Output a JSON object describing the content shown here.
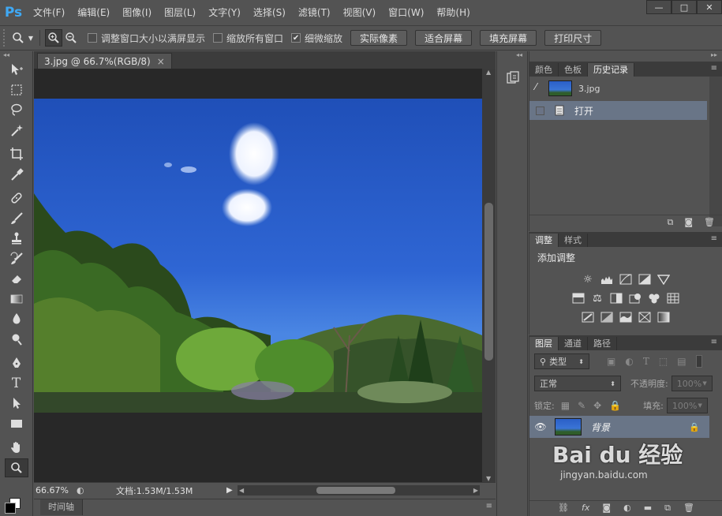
{
  "app": {
    "logo": "Ps"
  },
  "menu": [
    "文件(F)",
    "编辑(E)",
    "图像(I)",
    "图层(L)",
    "文字(Y)",
    "选择(S)",
    "滤镜(T)",
    "视图(V)",
    "窗口(W)",
    "帮助(H)"
  ],
  "window_controls": {
    "minimize": "—",
    "restore": "□",
    "close": "✕"
  },
  "options": {
    "resize_windows_label": "调整窗口大小以满屏显示",
    "zoom_all_label": "缩放所有窗口",
    "scrubby_label": "细微缩放",
    "actual_pixels": "实际像素",
    "fit_screen": "适合屏幕",
    "fill_screen": "填充屏幕",
    "print_size": "打印尺寸",
    "zoom_all_checked": false,
    "scrubby_checked": true
  },
  "document": {
    "tab_title": "3.jpg @ 66.7%(RGB/8)",
    "tab_close": "×",
    "zoom": "66.67%",
    "doc_size": "文档:1.53M/1.53M"
  },
  "timeline": {
    "label": "时间轴"
  },
  "history_panel": {
    "tabs": [
      "颜色",
      "色板",
      "历史记录"
    ],
    "active_tab": 2,
    "snapshot_name": "3.jpg",
    "items": [
      {
        "label": "打开"
      }
    ]
  },
  "adjustments_panel": {
    "tabs": [
      "调整",
      "样式"
    ],
    "active_tab": 0,
    "title": "添加调整"
  },
  "layers_panel": {
    "tabs": [
      "图层",
      "通道",
      "路径"
    ],
    "active_tab": 0,
    "filter_label": "类型",
    "blend_mode": "正常",
    "opacity_label": "不透明度:",
    "opacity_value": "100%",
    "lock_label": "锁定:",
    "fill_label": "填充:",
    "fill_value": "100%",
    "layers": [
      {
        "name": "背景",
        "visible": true,
        "locked": true
      }
    ]
  },
  "watermark": {
    "text": "Bai du 经验",
    "subtext": "jingyan.baidu.com"
  }
}
